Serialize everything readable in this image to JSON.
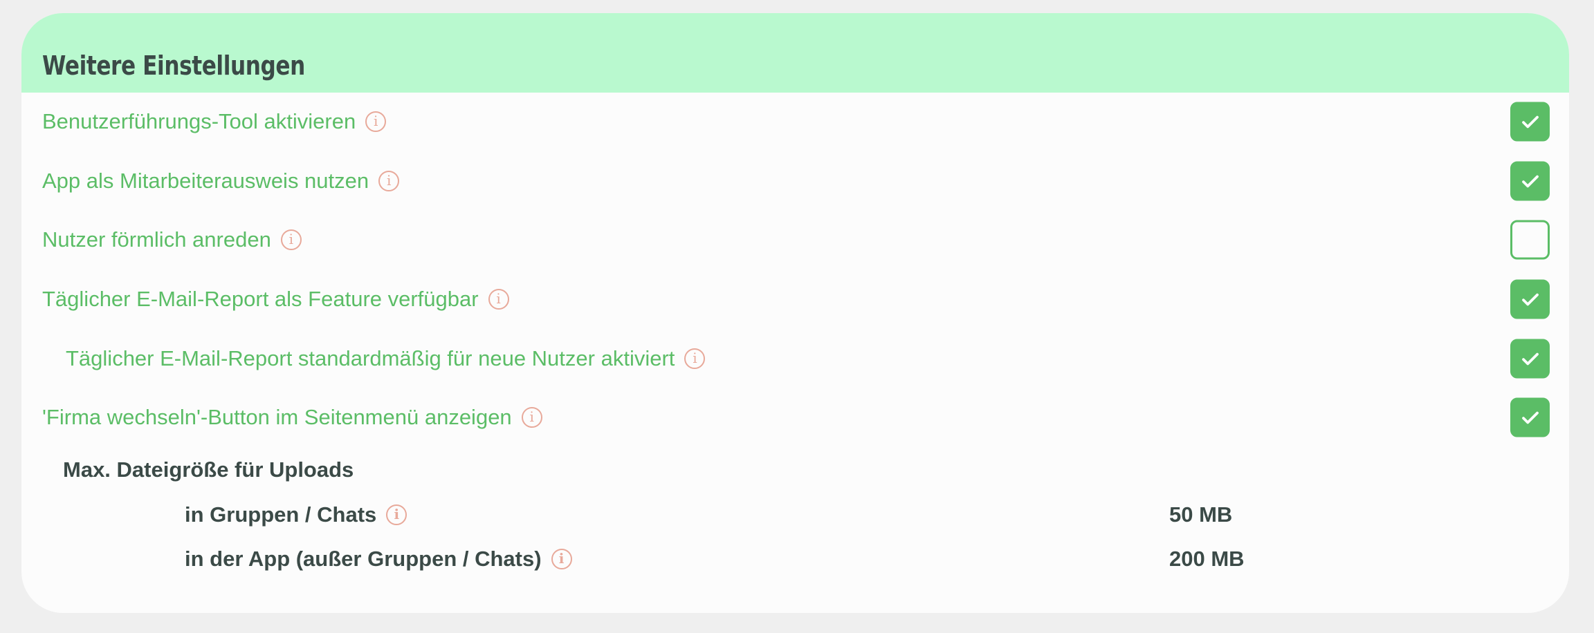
{
  "card": {
    "title": "Weitere Einstellungen"
  },
  "settings": [
    {
      "label": "Benutzerführungs-Tool aktivieren",
      "checked": true,
      "indent": false
    },
    {
      "label": "App als Mitarbeiterausweis nutzen",
      "checked": true,
      "indent": false
    },
    {
      "label": "Nutzer förmlich anreden",
      "checked": false,
      "indent": false
    },
    {
      "label": "Täglicher E-Mail-Report als Feature verfügbar",
      "checked": true,
      "indent": false
    },
    {
      "label": "Täglicher E-Mail-Report standardmäßig für neue Nutzer aktiviert",
      "checked": true,
      "indent": true
    },
    {
      "label": "'Firma wechseln'-Button im Seitenmenü anzeigen",
      "checked": true,
      "indent": false
    }
  ],
  "uploads": {
    "title": "Max. Dateigröße für Uploads",
    "rows": [
      {
        "label": "in Gruppen / Chats",
        "value": "50 MB"
      },
      {
        "label": "in der App (außer Gruppen / Chats)",
        "value": "200 MB"
      }
    ]
  },
  "icons": {
    "info": "info-icon",
    "check": "check-icon"
  },
  "colors": {
    "header_bg": "#b9f9cf",
    "accent_green": "#5bbd66",
    "info_icon": "#e8a99a",
    "text_dark": "#3b4a47"
  }
}
